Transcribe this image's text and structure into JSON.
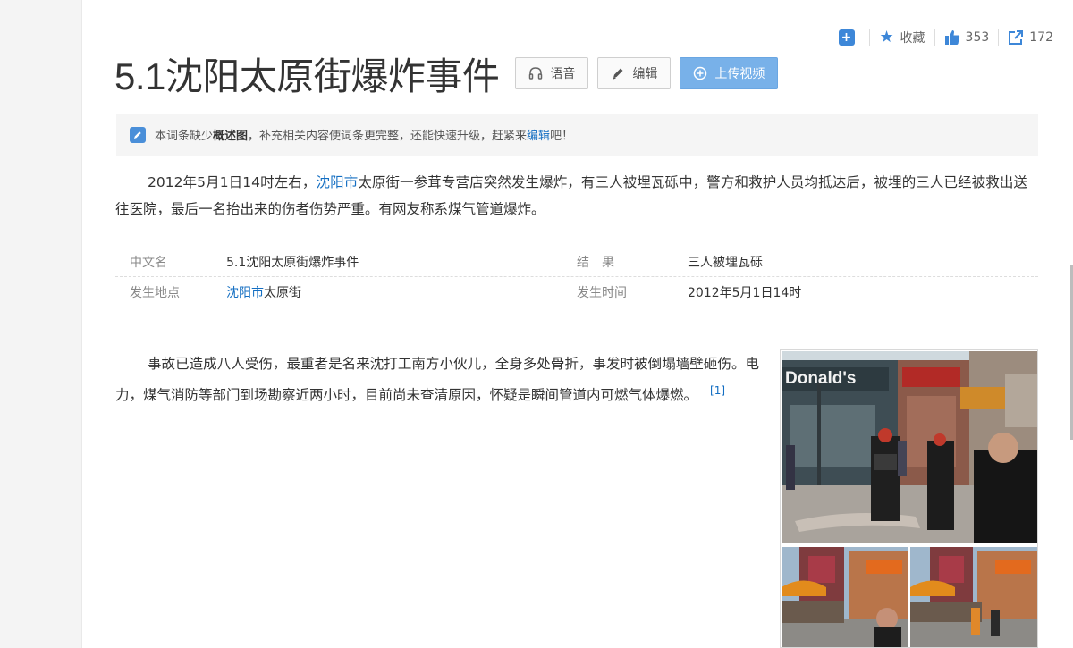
{
  "toolbar": {
    "favorite_label": "收藏",
    "like_count": "353",
    "share_count": "172"
  },
  "title": "5.1沈阳太原街爆炸事件",
  "buttons": {
    "voice": "语音",
    "edit": "编辑",
    "upload_video": "上传视频"
  },
  "notice": {
    "part1": "本词条缺少",
    "bold": "概述图",
    "part2": "，补充相关内容使词条更完整，还能快速升级，赶紧来",
    "link": "编辑",
    "part3": "吧！"
  },
  "summary": {
    "part1": "2012年5月1日14时左右，",
    "link": "沈阳市",
    "part2": "太原街一参茸专营店突然发生爆炸，有三人被埋瓦砾中，警方和救护人员均抵达后，被埋的三人已经被救出送往医院，最后一名抬出来的伤者伤势严重。有网友称系煤气管道爆炸。"
  },
  "infobox": {
    "rows": [
      {
        "name1": "中文名",
        "value1": "5.1沈阳太原街爆炸事件",
        "name2": "结　果",
        "value2": "三人被埋瓦砾"
      },
      {
        "name1": "发生地点",
        "value1_link": "沈阳市",
        "value1_rest": "太原街",
        "name2": "发生时间",
        "value2": "2012年5月1日14时"
      }
    ]
  },
  "body": {
    "text": "事故已造成八人受伤，最重者是名来沈打工南方小伙儿，全身多处骨折，事发时被倒塌墙壁砸伤。电力，煤气消防等部门到场勘察近两小时，目前尚未查清原因，怀疑是瞬间管道内可燃气体爆燃。",
    "citation": "[1]"
  },
  "photo": {
    "sign_text": "Donald's"
  },
  "colors": {
    "accent": "#3d87d8",
    "link": "#136ec2",
    "primary_button": "#78b1e9"
  },
  "icons": [
    "plus-square-icon",
    "star-icon",
    "thumbs-up-icon",
    "share-icon",
    "headphones-icon",
    "pencil-icon",
    "upload-plus-icon",
    "edit-icon"
  ]
}
